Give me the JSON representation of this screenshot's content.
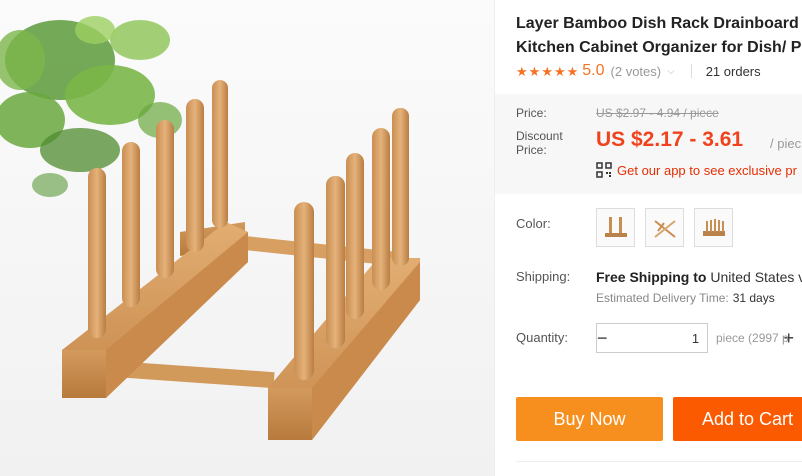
{
  "product": {
    "title_line1": "Layer Bamboo Dish Rack Drainboard D",
    "title_line2": "Kitchen Cabinet Organizer for Dish/ Pla"
  },
  "rating": {
    "value": "5.0",
    "votes": "(2 votes)",
    "orders": "21 orders",
    "stars": 5
  },
  "price": {
    "label": "Price:",
    "original": "US $2.97 - 4.94 / piece",
    "discount_label": "Discount Price:",
    "discount": "US $2.17 - 3.61",
    "unit": "/ piec",
    "app_promo": "Get our app to see exclusive pr"
  },
  "color": {
    "label": "Color:",
    "options": [
      "3-peg rack",
      "crossed rack",
      "6-peg rack"
    ]
  },
  "shipping": {
    "label": "Shipping:",
    "free": "Free Shipping to",
    "destination": "United States v",
    "delivery_label": "Estimated Delivery Time:",
    "delivery_value": "31 days"
  },
  "quantity": {
    "label": "Quantity:",
    "value": "1",
    "note": "piece (2997 p"
  },
  "actions": {
    "buy_now": "Buy Now",
    "add_to_cart": "Add to Cart"
  },
  "colors": {
    "accent_orange": "#f78f1e",
    "cart_orange": "#fb5a00",
    "price_red": "#f0431d",
    "star": "#f57224"
  }
}
